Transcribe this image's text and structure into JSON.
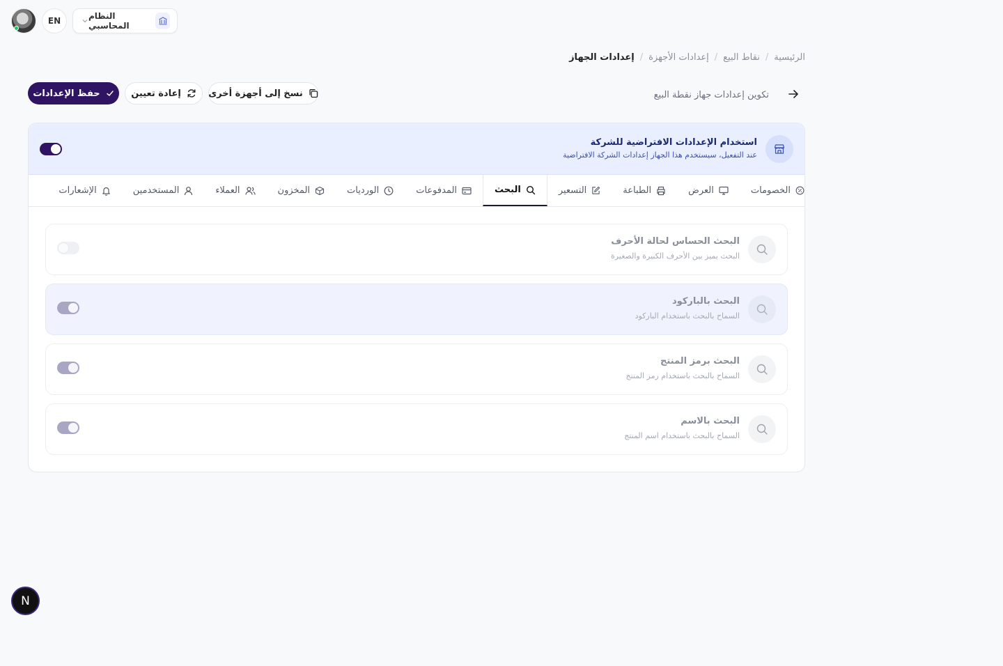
{
  "topbar": {
    "language_button": "EN",
    "system_select_label": "النظام المحاسبي"
  },
  "breadcrumb": [
    "الرئيسية",
    "نقاط البيع",
    "إعدادات الأجهزة",
    "إعدادات الجهاز"
  ],
  "header": {
    "subtitle": "تكوين إعدادات جهاز نقطة البيع"
  },
  "actions": {
    "save_label": "حفظ الإعدادات",
    "reset_label": "إعادة تعيين",
    "copy_label": "نسخ إلى أجهزة أخرى"
  },
  "default_settings": {
    "title": "استخدام الإعدادات الافتراضية للشركة",
    "description": "عند التفعيل، سيستخدم هذا الجهاز إعدادات الشركة الافتراضية",
    "enabled": true
  },
  "tabs": [
    {
      "label": "الخصومات",
      "icon": "percent-icon",
      "active": false
    },
    {
      "label": "العرض",
      "icon": "monitor-icon",
      "active": false
    },
    {
      "label": "الطباعة",
      "icon": "printer-icon",
      "active": false
    },
    {
      "label": "التسعير",
      "icon": "edit-icon",
      "active": false
    },
    {
      "label": "البحث",
      "icon": "search-icon",
      "active": true
    },
    {
      "label": "المدفوعات",
      "icon": "credit-card-icon",
      "active": false
    },
    {
      "label": "الورديات",
      "icon": "clock-icon",
      "active": false
    },
    {
      "label": "المخزون",
      "icon": "box-icon",
      "active": false
    },
    {
      "label": "العملاء",
      "icon": "users-icon",
      "active": false
    },
    {
      "label": "المستخدمين",
      "icon": "user-icon",
      "active": false
    },
    {
      "label": "الإشعارات",
      "icon": "bell-icon",
      "active": false
    }
  ],
  "search_settings": [
    {
      "title": "البحث الحساس لحالة الأحرف",
      "description": "البحث يميز بين الأحرف الكبيرة والصغيرة",
      "enabled": false,
      "icon": "search-icon"
    },
    {
      "title": "البحث بالباركود",
      "description": "السماح بالبحث باستخدام الباركود",
      "enabled": true,
      "icon": "search-icon"
    },
    {
      "title": "البحث برمز المنتج",
      "description": "السماح بالبحث باستخدام رمز المنتج",
      "enabled": true,
      "icon": "search-icon"
    },
    {
      "title": "البحث بالاسم",
      "description": "السماح بالبحث باستخدام اسم المنتج",
      "enabled": true,
      "icon": "search-icon"
    }
  ],
  "colors": {
    "primary": "#2f1463",
    "banner_bg": "#e9efff",
    "banner_title": "#1d2b6e",
    "banner_desc": "#3b4fb5"
  },
  "dev_badge": "N"
}
